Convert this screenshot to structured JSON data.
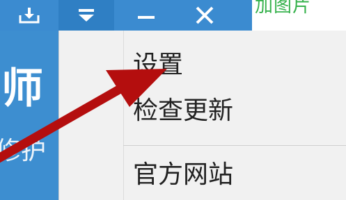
{
  "window": {
    "controls": [
      {
        "name": "download-icon"
      },
      {
        "name": "menu-dropdown-icon"
      },
      {
        "name": "minimize-icon"
      },
      {
        "name": "close-icon"
      }
    ]
  },
  "background": {
    "right_fragment": "加图片",
    "big_char": "师",
    "small_fragment": "修护"
  },
  "menu": {
    "items": [
      {
        "label": "设置"
      },
      {
        "label": "检查更新"
      },
      {
        "label": "官方网站"
      }
    ]
  },
  "colors": {
    "titlebar": "#3b8bd0",
    "active_button": "#2f7fc4",
    "menu_bg": "#f1f1f1",
    "arrow": "#b40e0e",
    "green_text": "#37b24d"
  }
}
